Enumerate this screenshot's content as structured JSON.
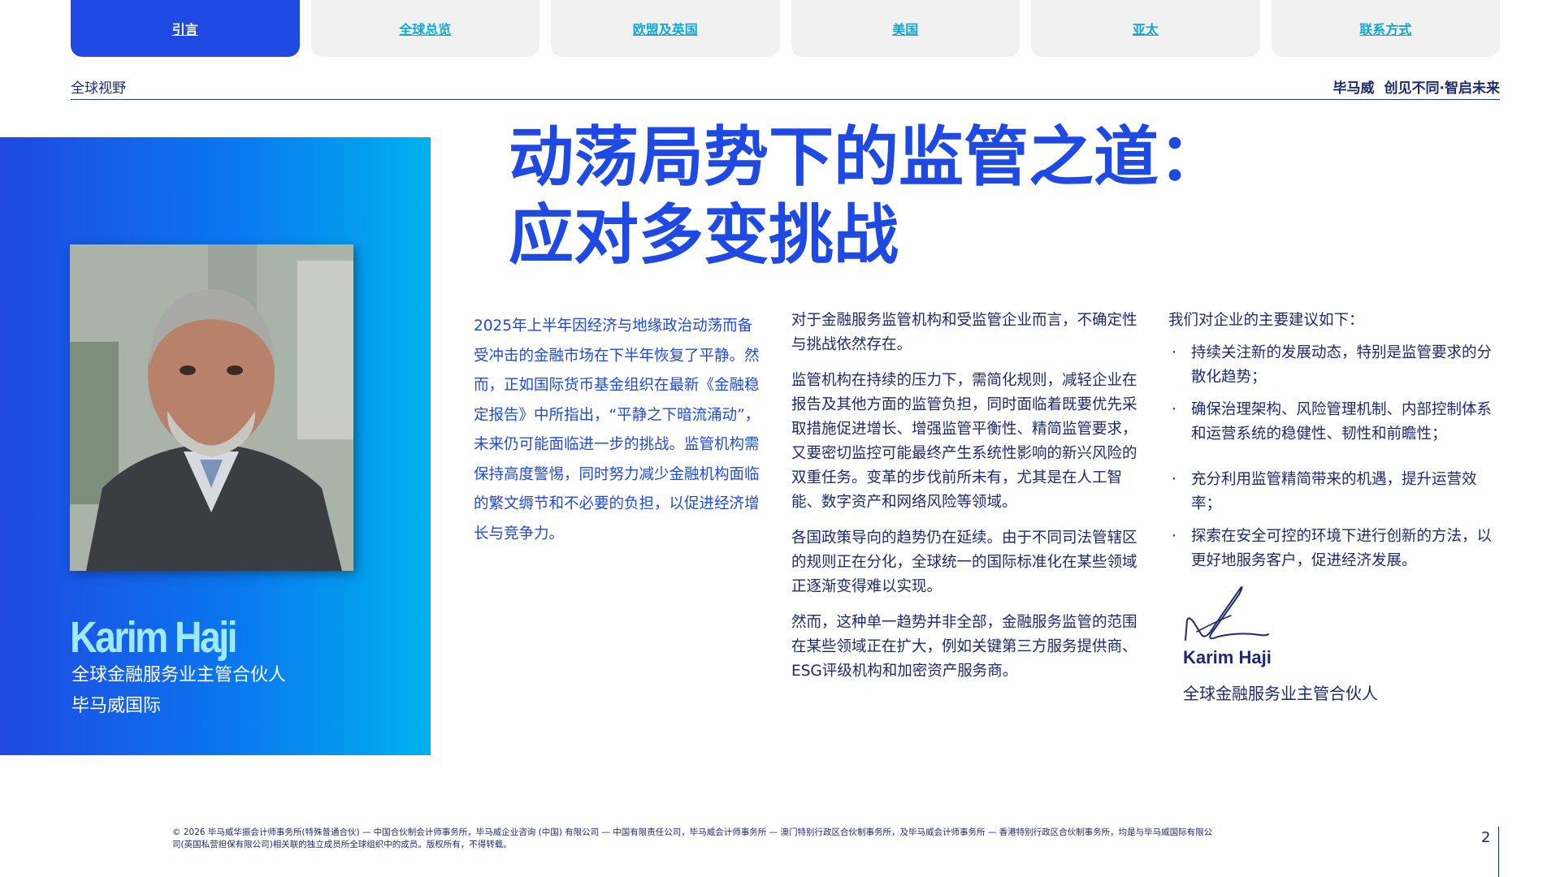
{
  "nav": {
    "tabs": [
      {
        "label": "引言",
        "active": true
      },
      {
        "label": "全球总览",
        "active": false
      },
      {
        "label": "欧盟及英国",
        "active": false
      },
      {
        "label": "美国",
        "active": false
      },
      {
        "label": "亚太",
        "active": false
      },
      {
        "label": "联系方式",
        "active": false
      }
    ]
  },
  "header": {
    "section": "全球视野",
    "brand": "毕马威",
    "tagline": "创见不同·智启未来"
  },
  "profile": {
    "name": "Karim Haji",
    "role_line1": "全球金融服务业主管合伙人",
    "role_line2": "毕马威国际"
  },
  "headline": {
    "line1": "动荡局势下的监管之道：",
    "line2": "应对多变挑战"
  },
  "column1": {
    "text": "2025年上半年因经济与地缘政治动荡而备受冲击的金融市场在下半年恢复了平静。然而，正如国际货币基金组织在最新《金融稳定报告》中所指出，“平静之下暗流涌动”，未来仍可能面临进一步的挑战。监管机构需保持高度警惕，同时努力减少金融机构面临的繁文缛节和不必要的负担，以促进经济增长与竞争力。"
  },
  "column2": {
    "paragraphs": [
      "对于金融服务监管机构和受监管企业而言，不确定性与挑战依然存在。",
      "监管机构在持续的压力下，需简化规则，减轻企业在报告及其他方面的监管负担，同时面临着既要优先采取措施促进增长、增强监管平衡性、精简监管要求，又要密切监控可能最终产生系统性影响的新兴风险的双重任务。变革的步伐前所未有，尤其是在人工智能、数字资产和网络风险等领域。",
      "各国政策导向的趋势仍在延续。由于不同司法管辖区的规则正在分化，全球统一的国际标准化在某些领域正逐渐变得难以实现。",
      "然而，这种单一趋势并非全部，金融服务监管的范围在某些领域正在扩大，例如关键第三方服务提供商、ESG评级机构和加密资产服务商。"
    ]
  },
  "column3": {
    "intro": "我们对企业的主要建议如下：",
    "bullet_char": "·",
    "recommendations": [
      "持续关注新的发展动态，特别是监管要求的分散化趋势；",
      "确保治理架构、风险管理机制、内部控制体系和运营系统的稳健性、韧性和前瞻性；",
      "充分利用监管精简带来的机遇，提升运营效率；",
      "探索在安全可控的环境下进行创新的方法，以更好地服务客户，促进经济发展。"
    ],
    "signoff_name": "Karim Haji",
    "signoff_role": "全球金融服务业主管合伙人"
  },
  "footer": {
    "copyright": "© 2026 毕马威华振会计师事务所(特殊普通合伙) — 中国合伙制会计师事务所，毕马威企业咨询 (中国) 有限公司 — 中国有限责任公司，毕马威会计师事务所 — 澳门特别行政区合伙制事务所，及毕马威会计师事务所 — 香港特别行政区合伙制事务所，均是与毕马威国际有限公司(英国私营担保有限公司)相关联的独立成员所全球组织中的成员。版权所有，不得转载。",
    "page_number": "2"
  },
  "colors": {
    "accent": "#1e49e2",
    "navy": "#1e2a6e",
    "cyan": "#00b2ef",
    "tab_inactive": "#f1f1f1",
    "tab_link": "#10a7d8"
  }
}
